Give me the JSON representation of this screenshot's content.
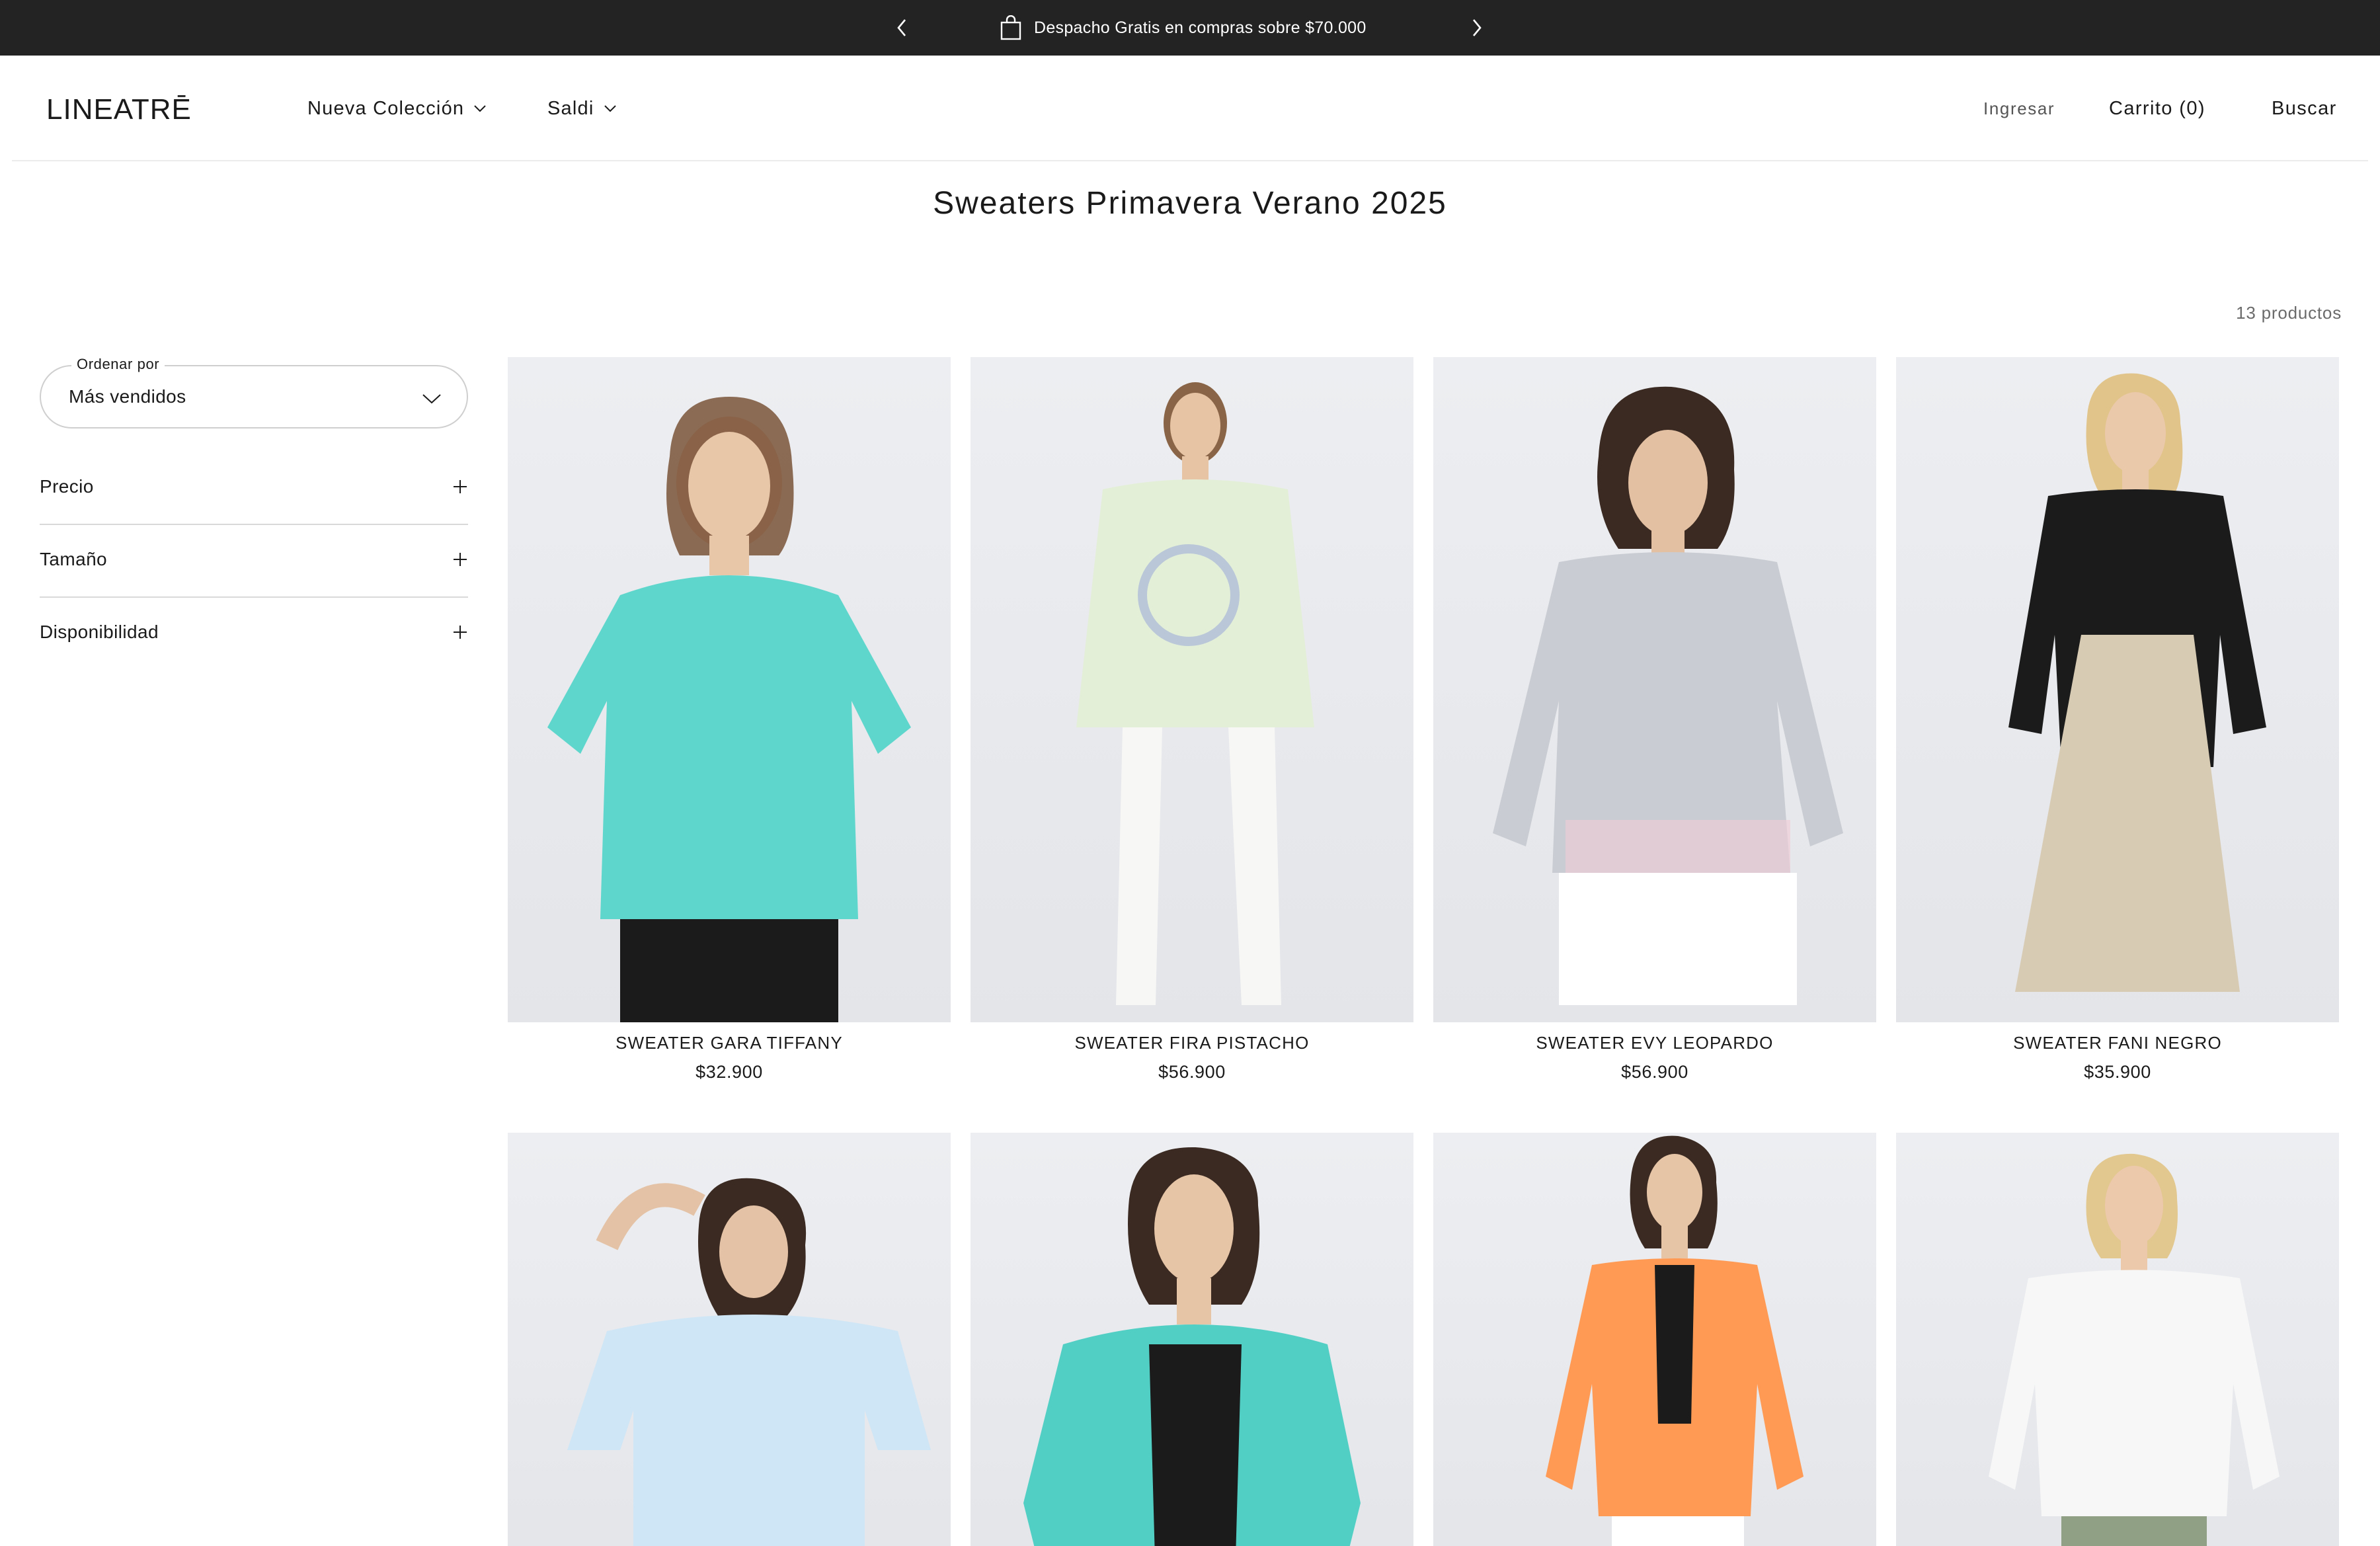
{
  "announcement": {
    "message": "Despacho Gratis en compras sobre $70.000",
    "icon": "shopping-bag-icon"
  },
  "header": {
    "logo_text": "LINEATRĒ",
    "nav": [
      {
        "label": "Nueva Colección",
        "icon": "chevron-down-icon"
      },
      {
        "label": "Saldi",
        "icon": "chevron-down-icon"
      }
    ],
    "login_label": "Ingresar",
    "cart_label": "Carrito (0)",
    "search_label": "Buscar"
  },
  "page": {
    "title": "Sweaters Primavera Verano 2025",
    "product_count": "13 productos"
  },
  "sort": {
    "label": "Ordenar por",
    "value": "Más vendidos"
  },
  "filters": [
    {
      "label": "Precio"
    },
    {
      "label": "Tamaño"
    },
    {
      "label": "Disponibilidad"
    }
  ],
  "products": [
    {
      "name": "SWEATER GARA TIFFANY",
      "price": "$32.900",
      "color": "#5fd6cc"
    },
    {
      "name": "SWEATER FIRA PISTACHO",
      "price": "$56.900",
      "color": "#e4efd8"
    },
    {
      "name": "SWEATER EVY LEOPARDO",
      "price": "$56.900",
      "color": "#c9ccd2"
    },
    {
      "name": "SWEATER FANI NEGRO",
      "price": "$35.900",
      "color": "#1b1b1b"
    },
    {
      "color": "#cfe6f6"
    },
    {
      "color": "#52cfc4"
    },
    {
      "color": "#ff9a55"
    },
    {
      "color": "#f7f7f7"
    }
  ],
  "colors": {
    "announcement_bg": "#232323",
    "text": "#1a1a1a"
  }
}
